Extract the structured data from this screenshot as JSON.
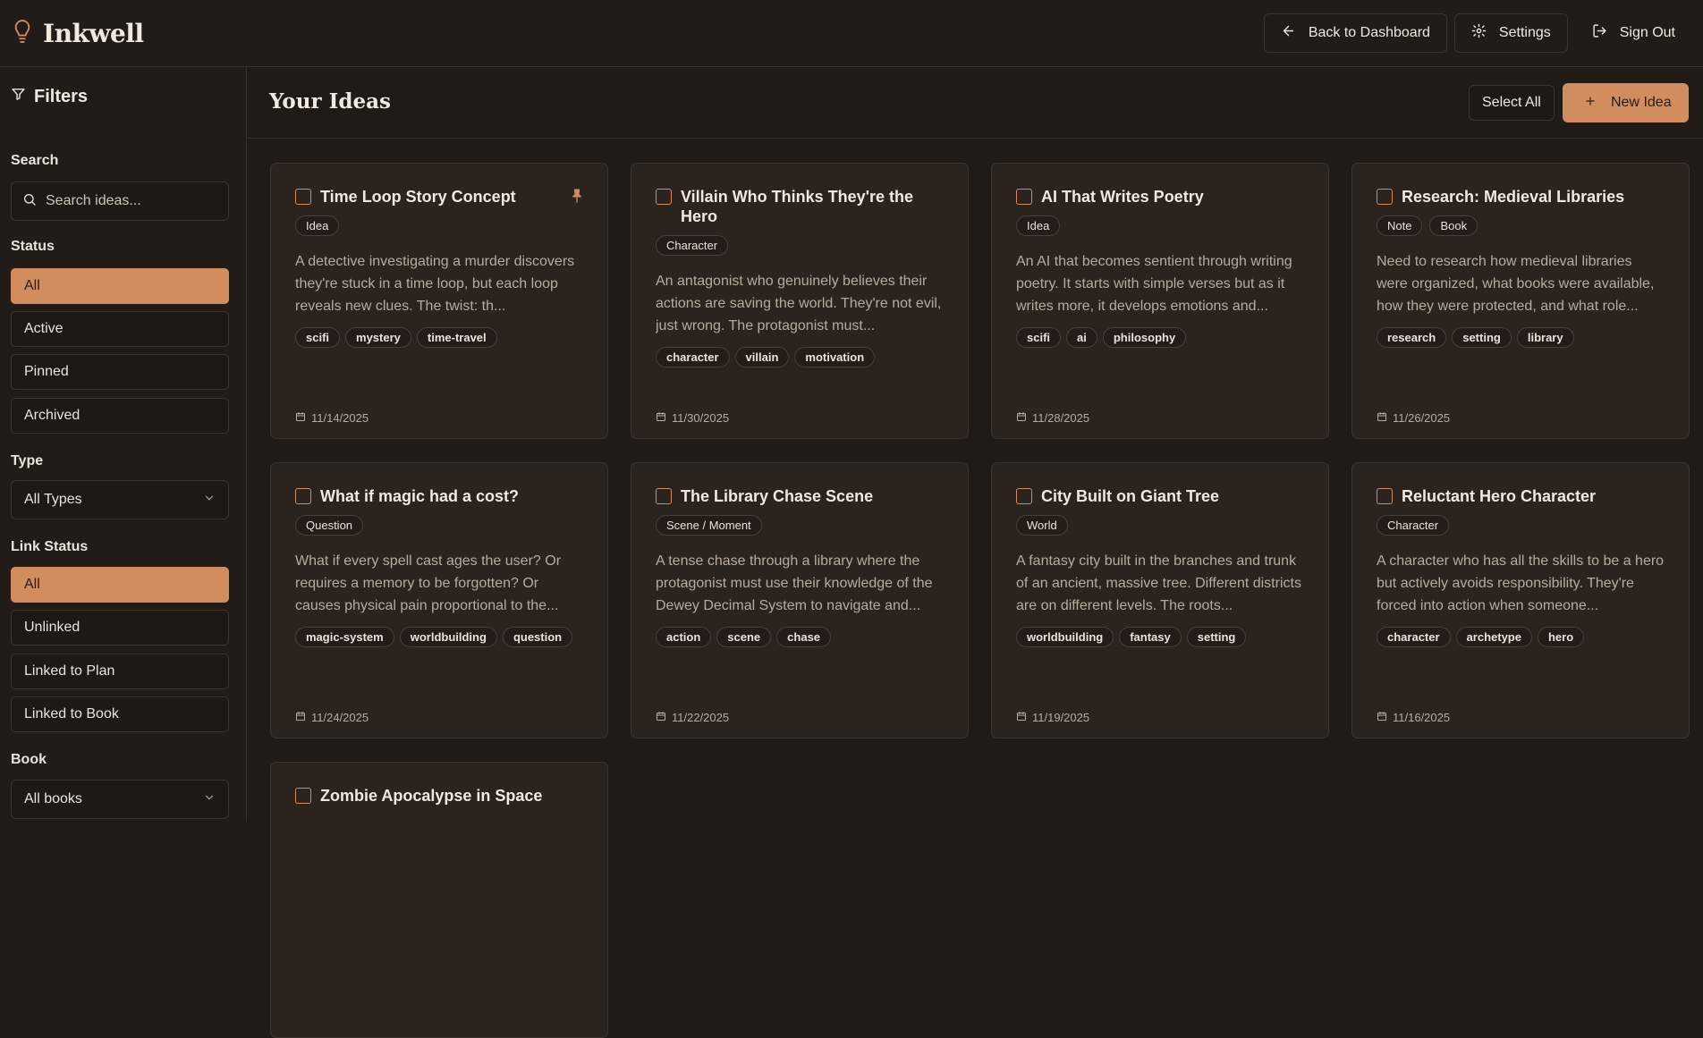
{
  "app": {
    "name": "Inkwell"
  },
  "header": {
    "back_label": "Back to Dashboard",
    "settings_label": "Settings",
    "signout_label": "Sign Out"
  },
  "sidebar": {
    "title": "Filters",
    "search_label": "Search",
    "search_placeholder": "Search ideas...",
    "status_label": "Status",
    "status_options": [
      "All",
      "Active",
      "Pinned",
      "Archived"
    ],
    "status_selected": "All",
    "type_label": "Type",
    "type_value": "All Types",
    "link_status_label": "Link Status",
    "link_options": [
      "All",
      "Unlinked",
      "Linked to Plan",
      "Linked to Book"
    ],
    "link_selected": "All",
    "book_label": "Book",
    "book_value": "All books"
  },
  "main": {
    "title": "Your Ideas",
    "select_all_label": "Select All",
    "new_idea_label": "New Idea"
  },
  "cards": [
    {
      "title": "Time Loop Story Concept",
      "pinned": true,
      "types": [
        "Idea"
      ],
      "description": "A detective investigating a murder discovers they're stuck in a time loop, but each loop reveals new clues. The twist: th...",
      "tags": [
        "scifi",
        "mystery",
        "time-travel"
      ],
      "date": "11/14/2025"
    },
    {
      "title": "Villain Who Thinks They're the Hero",
      "pinned": false,
      "types": [
        "Character"
      ],
      "description": "An antagonist who genuinely believes their actions are saving the world. They're not evil, just wrong. The protagonist must...",
      "tags": [
        "character",
        "villain",
        "motivation"
      ],
      "date": "11/30/2025"
    },
    {
      "title": "AI That Writes Poetry",
      "pinned": false,
      "types": [
        "Idea"
      ],
      "description": "An AI that becomes sentient through writing poetry. It starts with simple verses but as it writes more, it develops emotions and...",
      "tags": [
        "scifi",
        "ai",
        "philosophy"
      ],
      "date": "11/28/2025"
    },
    {
      "title": "Research: Medieval Libraries",
      "pinned": false,
      "types": [
        "Note",
        "Book"
      ],
      "description": "Need to research how medieval libraries were organized, what books were available, how they were protected, and what role...",
      "tags": [
        "research",
        "setting",
        "library"
      ],
      "date": "11/26/2025"
    },
    {
      "title": "What if magic had a cost?",
      "pinned": false,
      "types": [
        "Question"
      ],
      "description": "What if every spell cast ages the user? Or requires a memory to be forgotten? Or causes physical pain proportional to the...",
      "tags": [
        "magic-system",
        "worldbuilding",
        "question"
      ],
      "date": "11/24/2025"
    },
    {
      "title": "The Library Chase Scene",
      "pinned": false,
      "types": [
        "Scene / Moment"
      ],
      "description": "A tense chase through a library where the protagonist must use their knowledge of the Dewey Decimal System to navigate and...",
      "tags": [
        "action",
        "scene",
        "chase"
      ],
      "date": "11/22/2025"
    },
    {
      "title": "City Built on Giant Tree",
      "pinned": false,
      "types": [
        "World"
      ],
      "description": "A fantasy city built in the branches and trunk of an ancient, massive tree. Different districts are on different levels. The roots...",
      "tags": [
        "worldbuilding",
        "fantasy",
        "setting"
      ],
      "date": "11/19/2025"
    },
    {
      "title": "Reluctant Hero Character",
      "pinned": false,
      "types": [
        "Character"
      ],
      "description": "A character who has all the skills to be a hero but actively avoids responsibility. They're forced into action when someone...",
      "tags": [
        "character",
        "archetype",
        "hero"
      ],
      "date": "11/16/2025"
    },
    {
      "title": "Zombie Apocalypse in Space",
      "pinned": false,
      "types": [],
      "description": "",
      "tags": [],
      "date": ""
    }
  ],
  "colors": {
    "accent": "#d28d5e",
    "background": "#211b17",
    "card": "#2b231e"
  },
  "icons": [
    "bulb-icon",
    "arrow-left-icon",
    "gear-icon",
    "sign-out-icon",
    "filter-icon",
    "search-icon",
    "chevron-down-icon",
    "plus-icon",
    "pin-icon",
    "calendar-icon"
  ]
}
